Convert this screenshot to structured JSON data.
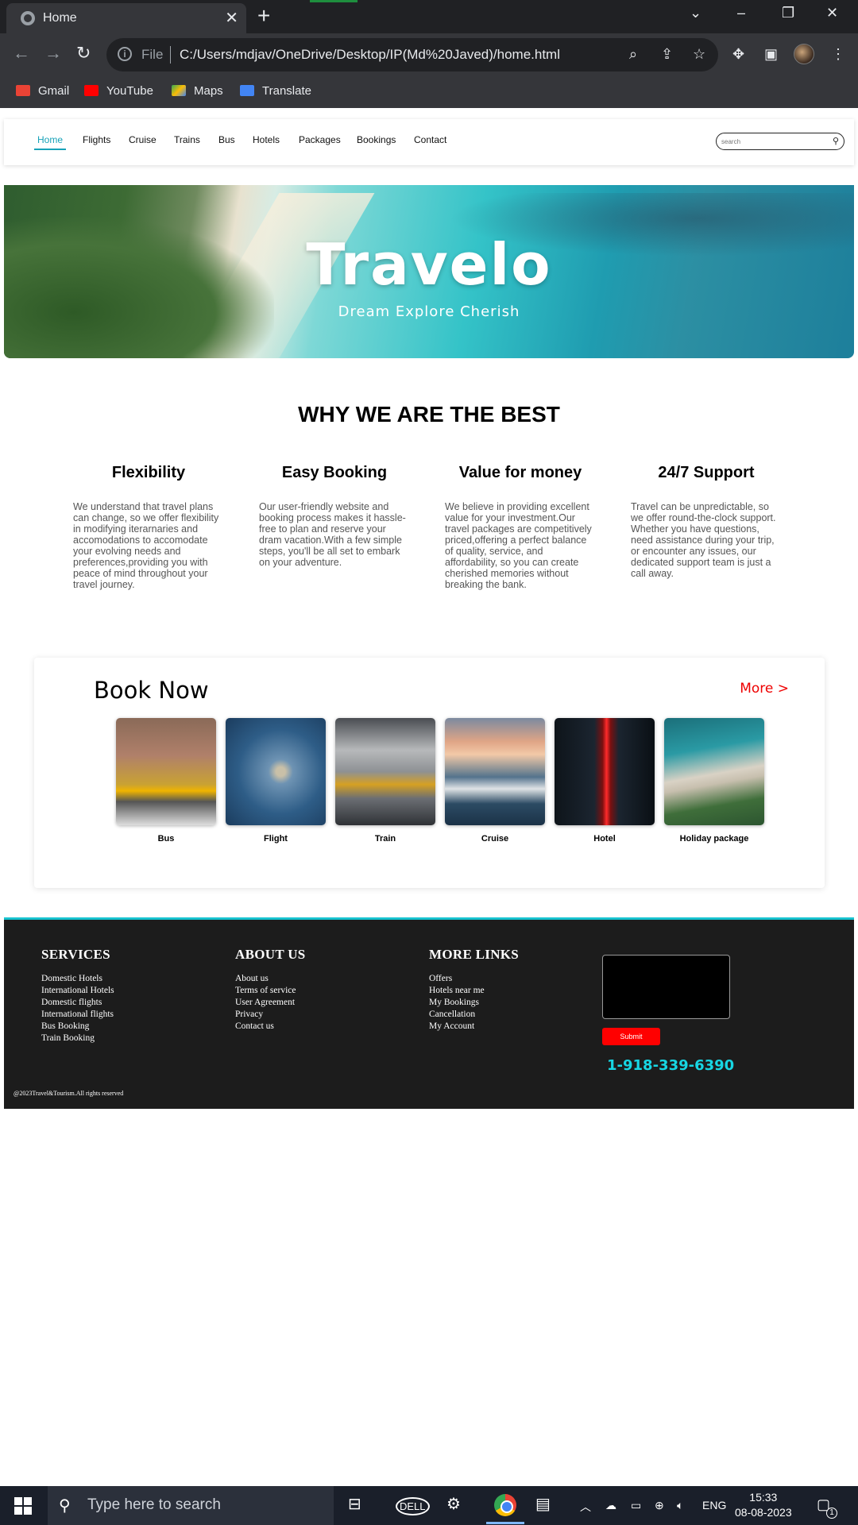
{
  "browser": {
    "tab_title": "Home",
    "file_label": "File",
    "url": "C:/Users/mdjav/OneDrive/Desktop/IP(Md%20Javed)/home.html",
    "bookmarks": [
      "Gmail",
      "YouTube",
      "Maps",
      "Translate"
    ]
  },
  "nav": {
    "links": [
      "Home",
      "Flights",
      "Cruise",
      "Trains",
      "Bus",
      "Hotels",
      "Packages",
      "Bookings",
      "Contact"
    ],
    "active": "Home",
    "search_placeholder": "search"
  },
  "hero": {
    "brand": "Travelo",
    "tagline": "Dream Explore Cherish"
  },
  "why": {
    "title": "WHY WE ARE THE BEST",
    "features": [
      {
        "title": "Flexibility",
        "text": "We understand that travel plans can change, so we offer flexibility in modifying iterarnaries and accomodations to accomodate your evolving needs and preferences,providing you with peace of mind throughout your travel journey."
      },
      {
        "title": "Easy Booking",
        "text": "Our user-friendly website and booking process makes it hassle-free to plan and reserve your dram vacation.With a few simple steps, you'll be all set to embark on your adventure."
      },
      {
        "title": "Value for money",
        "text": "We believe in providing excellent value for your investment.Our travel packages are competitively priced,offering a perfect balance of quality, service, and affordability, so you can create cherished memories without breaking the bank."
      },
      {
        "title": "24/7 Support",
        "text": "Travel can be unpredictable, so we offer round-the-clock support. Whether you have questions, need assistance during your trip, or encounter any issues, our dedicated support team is just a call away."
      }
    ]
  },
  "book": {
    "title": "Book Now",
    "more": "More >",
    "items": [
      "Bus",
      "Flight",
      "Train",
      "Cruise",
      "Hotel",
      "Holiday package"
    ]
  },
  "footer": {
    "services": {
      "title": "SERVICES",
      "links": [
        "Domestic Hotels",
        "International Hotels",
        "Domestic flights",
        "International flights",
        "Bus Booking",
        "Train Booking"
      ]
    },
    "about": {
      "title": "ABOUT US",
      "links": [
        "About us",
        "Terms of service",
        "User Agreement",
        "Privacy",
        "Contact us"
      ]
    },
    "more": {
      "title": "MORE LINKS",
      "links": [
        "Offers",
        "Hotels near me",
        "My Bookings",
        "Cancellation",
        "My Account"
      ]
    },
    "submit": "Submit",
    "phone": "1-918-339-6390",
    "copyright": "@2023Travel&Tourism.All rights reserved"
  },
  "taskbar": {
    "search_placeholder": "Type here to search",
    "lang": "ENG",
    "time": "15:33",
    "date": "08-08-2023",
    "notifications": "1"
  },
  "colors": {
    "accent": "#17a2b8",
    "footer_bg": "#1c1c1c",
    "phone": "#17d6e3",
    "submit": "#ff0000",
    "more_link": "#ee0000"
  }
}
